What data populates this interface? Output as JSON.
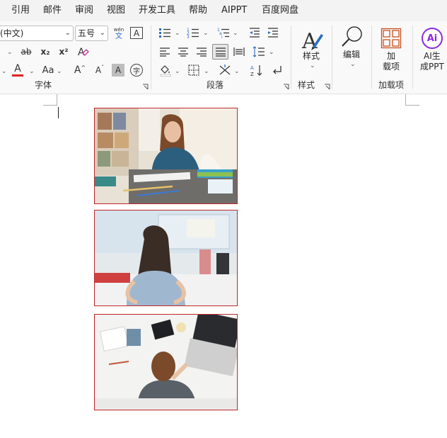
{
  "menu": {
    "tabs": [
      "引用",
      "邮件",
      "审阅",
      "视图",
      "开发工具",
      "帮助",
      "AIPPT",
      "百度网盘"
    ]
  },
  "font": {
    "name_value": "(中文)",
    "size_value": "五号",
    "phonetic_top": "wén",
    "phonetic_bottom": "文",
    "char_border": "A",
    "strikethrough": "ab",
    "subscript": "x₂",
    "superscript": "x²",
    "font_color_glyph": "A",
    "change_case": "Aa",
    "grow_font": "A",
    "shrink_font": "A",
    "char_shading": "A",
    "enclose_char": "字",
    "group_label": "字体"
  },
  "paragraph": {
    "group_label": "段落"
  },
  "styles": {
    "button_label": "样式",
    "group_label": "样式"
  },
  "editing": {
    "button_label": "编辑"
  },
  "addins": {
    "button_label_line1": "加",
    "button_label_line2": "载项",
    "group_label": "加载项"
  },
  "ai": {
    "icon_text": "Ai",
    "button_label_line1": "AI生",
    "button_label_line2": "成PPT"
  },
  "colors": {
    "accent_red": "#e02222",
    "photo_border": "#c0262b",
    "ai_purple": "#8a2be2",
    "addin_orange": "#c8501e"
  }
}
